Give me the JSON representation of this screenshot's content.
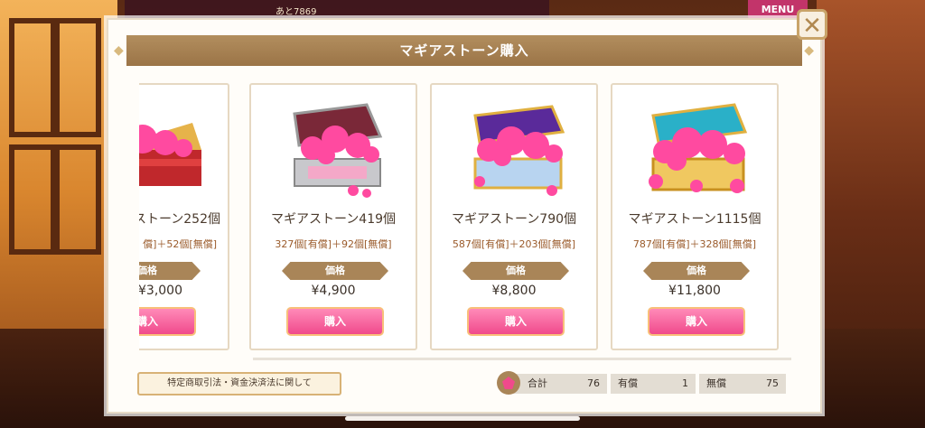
{
  "hud": {
    "text": "あと7869",
    "menu_label": "MENU"
  },
  "dialog": {
    "title": "マギアストーン購入",
    "close_label": "✕"
  },
  "products": [
    {
      "name": "ストーン252個",
      "breakdown": "償]＋52個[無償]",
      "price_label": "価格",
      "price": "¥3,000",
      "buy_label": "購入"
    },
    {
      "name": "マギアストーン419個",
      "breakdown": "327個[有償]＋92個[無償]",
      "price_label": "価格",
      "price": "¥4,900",
      "buy_label": "購入"
    },
    {
      "name": "マギアストーン790個",
      "breakdown": "587個[有償]＋203個[無償]",
      "price_label": "価格",
      "price": "¥8,800",
      "buy_label": "購入"
    },
    {
      "name": "マギアストーン1115個",
      "breakdown": "787個[有償]＋328個[無償]",
      "price_label": "価格",
      "price": "¥11,800",
      "buy_label": "購入"
    }
  ],
  "legal_button": "特定商取引法・資金決済法に関して",
  "totals": {
    "total_label": "合計",
    "total_value": "76",
    "paid_label": "有償",
    "paid_value": "1",
    "free_label": "無償",
    "free_value": "75"
  },
  "colors": {
    "accent_pink": "#f04a8c",
    "title_brown": "#a98558"
  }
}
